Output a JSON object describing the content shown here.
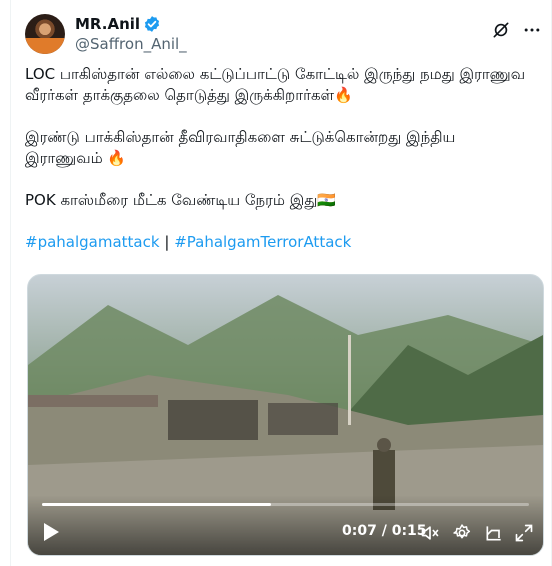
{
  "author": {
    "display_name": "MR.Anil",
    "handle": "@Saffron_Anil_"
  },
  "tweet": {
    "line1": "LOC பாகிஸ்தான் எல்லை கட்டுப்பாட்டு கோட்டில் இருந்து நமது இராணுவ வீரர்கள் தாக்குதலை தொடுத்து இருக்கிறார்கள்🔥",
    "line2": "இரண்டு பாக்கிஸ்தான் தீவிரவாதிகளை சுட்டுக்கொன்றது இந்திய இராணுவம் 🔥",
    "line3": "POK காஸ்மீரை மீட்க வேண்டிய நேரம் இது🇮🇳",
    "hashtag1": "#pahalgamattack",
    "separator": "|",
    "hashtag2": "#PahalgamTerrorAttack"
  },
  "video": {
    "time_current": "0:07",
    "time_separator": "/",
    "time_total": "0:15",
    "progress_fraction": 0.47
  },
  "colors": {
    "accent": "#1d9bf0",
    "text": "#0f1419",
    "secondary": "#536471"
  },
  "icons": [
    "verified-badge-icon",
    "grok-icon",
    "more-icon",
    "play-icon",
    "mute-icon",
    "settings-icon",
    "minimize-player-icon",
    "fullscreen-icon"
  ]
}
